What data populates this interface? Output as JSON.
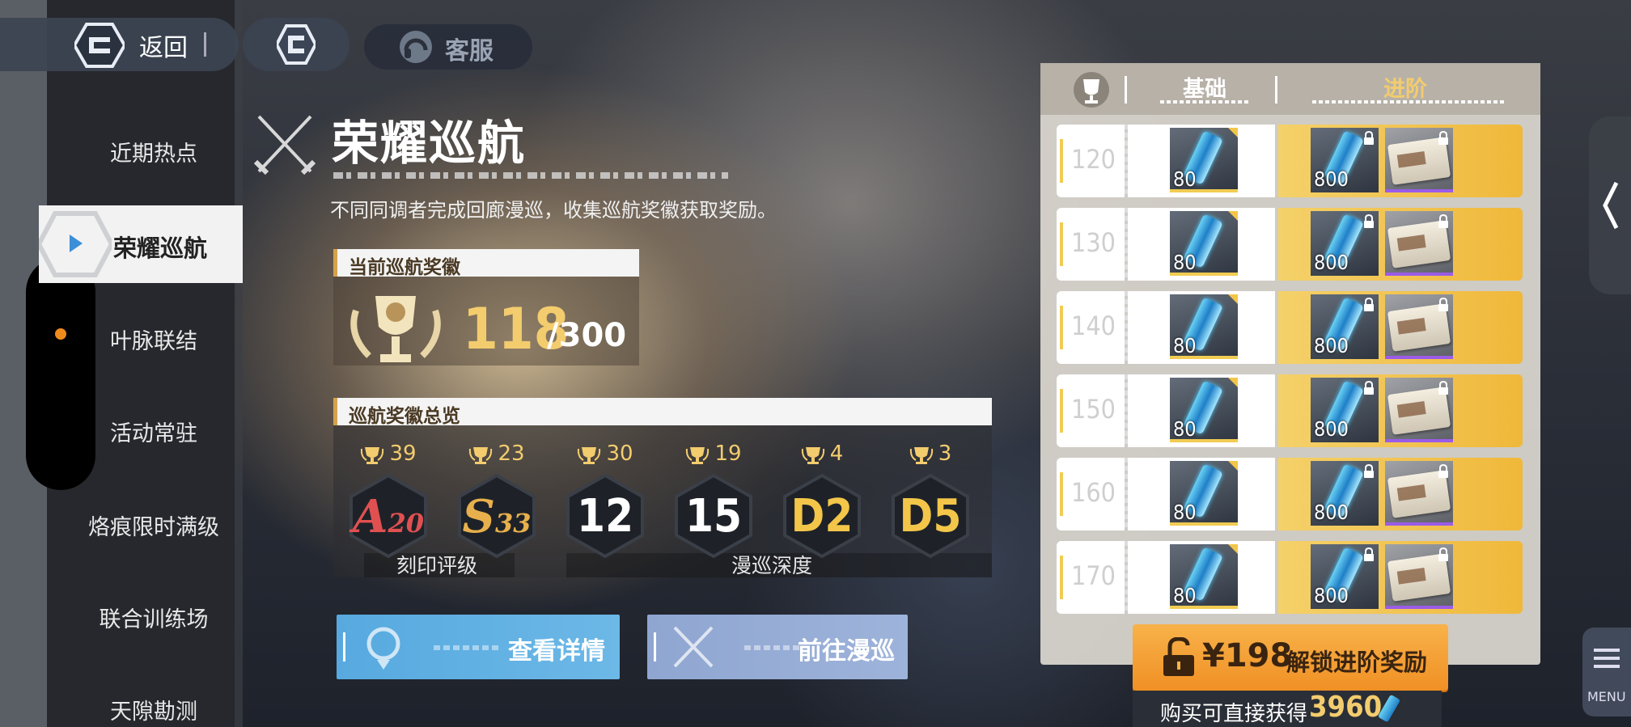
{
  "topbar": {
    "back_label": "返回",
    "service_label": "客服"
  },
  "nav": {
    "items": [
      {
        "label": "近期热点"
      },
      {
        "label": "荣耀巡航",
        "active": true
      },
      {
        "label": "叶脉联结"
      },
      {
        "label": "活动常驻"
      },
      {
        "label": "烙痕限时满级"
      },
      {
        "label": "联合训练场"
      },
      {
        "label": "天隙勘测"
      }
    ]
  },
  "main": {
    "title": "荣耀巡航",
    "subtitle": "不同同调者完成回廊漫巡，收集巡航奖徽获取奖励。",
    "current": {
      "header": "当前巡航奖徽",
      "value": "118",
      "max": "/300"
    },
    "overview": {
      "header": "巡航奖徽总览",
      "columns": [
        {
          "count": "39",
          "badge": "A",
          "sub": "20",
          "color": "#e05050"
        },
        {
          "count": "23",
          "badge": "S",
          "sub": "33",
          "color": "#e8b04c"
        },
        {
          "count": "30",
          "badge": "12",
          "sub": "",
          "color": "#ffffff"
        },
        {
          "count": "19",
          "badge": "15",
          "sub": "",
          "color": "#ffffff"
        },
        {
          "count": "4",
          "badge": "D2",
          "sub": "",
          "color": "#f3c64a"
        },
        {
          "count": "3",
          "badge": "D5",
          "sub": "",
          "color": "#f3c64a"
        }
      ],
      "label_a": "刻印评级",
      "label_b": "漫巡深度"
    },
    "buttons": {
      "detail": "查看详情",
      "go": "前往漫巡"
    }
  },
  "rewards": {
    "basic_label": "基础",
    "advanced_label": "进阶",
    "rows": [
      {
        "level": "120",
        "basic_qty": "80",
        "adv_qty": "800"
      },
      {
        "level": "130",
        "basic_qty": "80",
        "adv_qty": "800"
      },
      {
        "level": "140",
        "basic_qty": "80",
        "adv_qty": "800"
      },
      {
        "level": "150",
        "basic_qty": "80",
        "adv_qty": "800"
      },
      {
        "level": "160",
        "basic_qty": "80",
        "adv_qty": "800"
      },
      {
        "level": "170",
        "basic_qty": "80",
        "adv_qty": "800"
      }
    ],
    "unlock_price": "¥198",
    "unlock_text": "解锁进阶奖励",
    "direct_text": "购买可直接获得",
    "direct_value": "3960"
  },
  "side": {
    "menu_label": "MENU"
  }
}
